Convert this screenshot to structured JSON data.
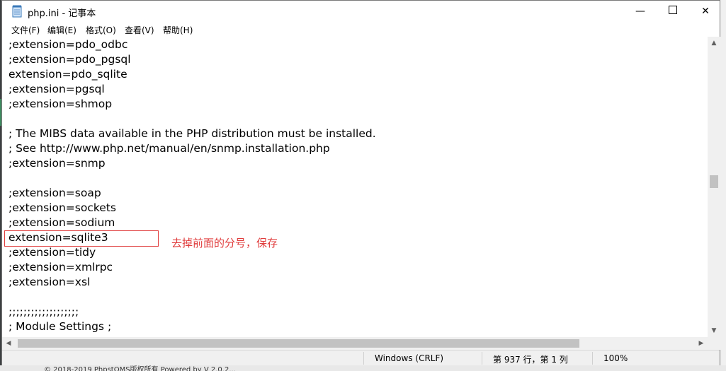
{
  "window": {
    "title": "php.ini - 记事本",
    "minimize_glyph": "—",
    "close_glyph": "✕"
  },
  "menu": [
    {
      "label": "文件(F)"
    },
    {
      "label": "编辑(E)"
    },
    {
      "label": "格式(O)"
    },
    {
      "label": "查看(V)"
    },
    {
      "label": "帮助(H)"
    }
  ],
  "editor": {
    "lines": [
      ";extension=pdo_odbc",
      ";extension=pdo_pgsql",
      "extension=pdo_sqlite",
      ";extension=pgsql",
      ";extension=shmop",
      "",
      "; The MIBS data available in the PHP distribution must be installed.",
      "; See http://www.php.net/manual/en/snmp.installation.php",
      ";extension=snmp",
      "",
      ";extension=soap",
      ";extension=sockets",
      ";extension=sodium",
      "extension=sqlite3",
      ";extension=tidy",
      ";extension=xmlrpc",
      ";extension=xsl",
      "",
      ";;;;;;;;;;;;;;;;;;;",
      "; Module Settings ;"
    ],
    "annotation": "去掉前面的分号，保存",
    "highlight_color": "#e03c3c"
  },
  "status": {
    "encoding": "Windows (CRLF)",
    "position": "第 937 行，第 1 列",
    "zoom": "100%"
  },
  "background": {
    "footer_text": "© 2018-2019 PhpstOMS版权所有 Powered by V 2.0.2..."
  },
  "icons": {
    "app": "notepad-icon",
    "up": "chevron-up-icon",
    "down": "chevron-down-icon",
    "left": "chevron-left-icon",
    "right": "chevron-right-icon"
  }
}
